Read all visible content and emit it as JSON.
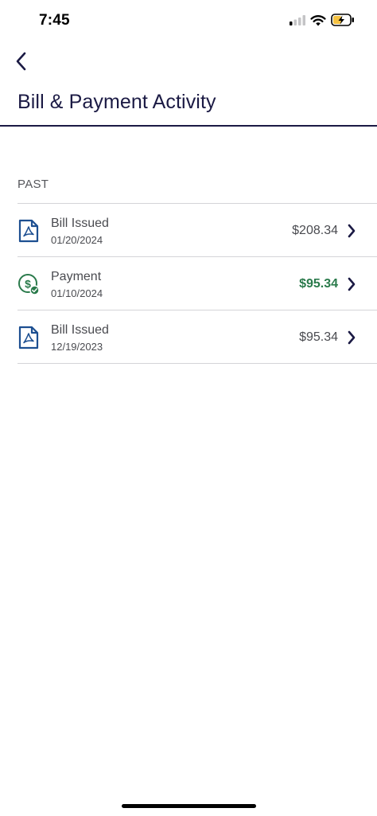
{
  "status_bar": {
    "time": "7:45"
  },
  "page": {
    "title": "Bill & Payment Activity"
  },
  "section": {
    "label": "PAST"
  },
  "colors": {
    "brand_navy": "#1b1a44",
    "bill_icon": "#1d4f91",
    "payment_green": "#2a7a4b"
  },
  "activity": [
    {
      "title": "Bill Issued",
      "date": "01/20/2024",
      "amount": "$208.34",
      "icon": "pdf-document-icon"
    },
    {
      "title": "Payment",
      "date": "01/10/2024",
      "amount": "$95.34",
      "icon": "dollar-check-icon"
    },
    {
      "title": "Bill Issued",
      "date": "12/19/2023",
      "amount": "$95.34",
      "icon": "pdf-document-icon"
    }
  ]
}
